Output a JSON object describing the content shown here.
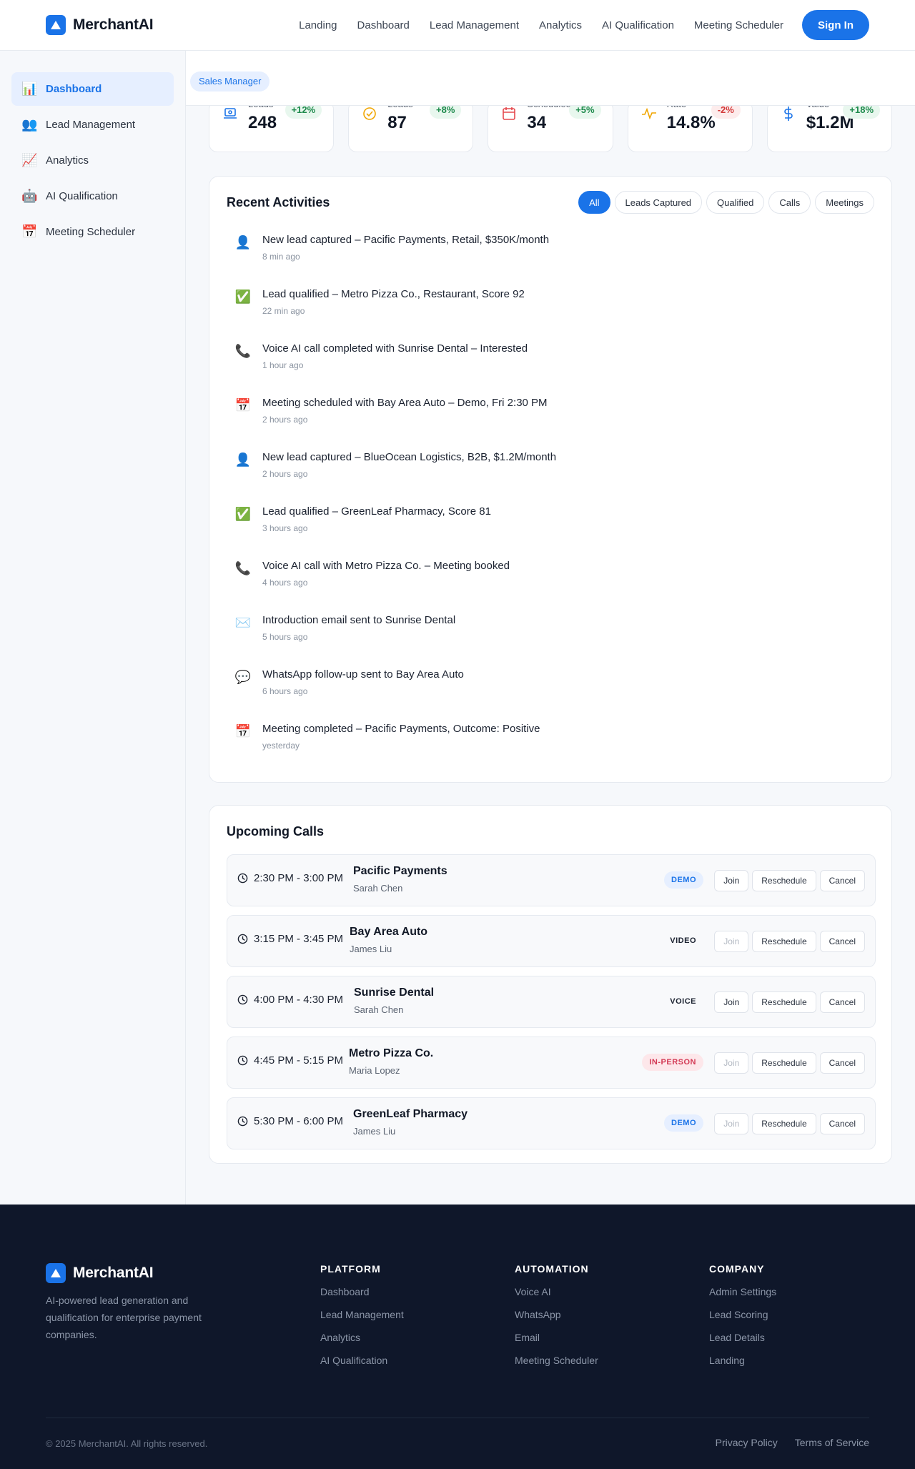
{
  "brand": {
    "name": "MerchantAI"
  },
  "nav": {
    "links": [
      "Landing",
      "Dashboard",
      "Lead Management",
      "Analytics",
      "AI Qualification",
      "Meeting Scheduler"
    ],
    "signin": "Sign In"
  },
  "sidebar": {
    "items": [
      {
        "label": "Dashboard",
        "icon": "bar-chart-icon",
        "glyph": "📊",
        "active": true
      },
      {
        "label": "Lead Management",
        "icon": "users-icon",
        "glyph": "👥",
        "active": false
      },
      {
        "label": "Analytics",
        "icon": "trend-chart-icon",
        "glyph": "📈",
        "active": false
      },
      {
        "label": "AI Qualification",
        "icon": "robot-icon",
        "glyph": "🤖",
        "active": false
      },
      {
        "label": "Meeting Scheduler",
        "icon": "calendar-icon",
        "glyph": "📅",
        "active": false
      }
    ]
  },
  "header": {
    "role": "Sales Manager"
  },
  "stats": [
    {
      "label": "Leads",
      "value": "248",
      "change": "+12%",
      "trend": "up",
      "icon": "laptop-icon",
      "color": "#1a73e8"
    },
    {
      "label": "Leads",
      "value": "87",
      "change": "+8%",
      "trend": "up",
      "icon": "check-circle-icon",
      "color": "#f0a500"
    },
    {
      "label": "Scheduled",
      "value": "34",
      "change": "+5%",
      "trend": "up",
      "icon": "calendar-icon",
      "color": "#e5484d"
    },
    {
      "label": "Rate",
      "value": "14.8%",
      "change": "-2%",
      "trend": "down",
      "icon": "activity-icon",
      "color": "#f0a500"
    },
    {
      "label": "Value",
      "value": "$1.2M",
      "change": "+18%",
      "trend": "up",
      "icon": "dollar-icon",
      "color": "#1a73e8"
    }
  ],
  "activities": {
    "title": "Recent Activities",
    "filters": [
      "All",
      "Leads Captured",
      "Qualified",
      "Calls",
      "Meetings"
    ],
    "items": [
      {
        "icon": "user-icon",
        "glyph": "👤",
        "text": "New lead captured – Pacific Payments, Retail, $350K/month",
        "time": "8 min ago"
      },
      {
        "icon": "check-icon",
        "glyph": "✅",
        "text": "Lead qualified – Metro Pizza Co., Restaurant, Score 92",
        "time": "22 min ago"
      },
      {
        "icon": "phone-icon",
        "glyph": "📞",
        "text": "Voice AI call completed with Sunrise Dental – Interested",
        "time": "1 hour ago"
      },
      {
        "icon": "calendar-icon",
        "glyph": "📅",
        "text": "Meeting scheduled with Bay Area Auto – Demo, Fri 2:30 PM",
        "time": "2 hours ago"
      },
      {
        "icon": "user-icon",
        "glyph": "👤",
        "text": "New lead captured – BlueOcean Logistics, B2B, $1.2M/month",
        "time": "2 hours ago"
      },
      {
        "icon": "check-icon",
        "glyph": "✅",
        "text": "Lead qualified – GreenLeaf Pharmacy, Score 81",
        "time": "3 hours ago"
      },
      {
        "icon": "phone-icon",
        "glyph": "📞",
        "text": "Voice AI call with Metro Pizza Co. – Meeting booked",
        "time": "4 hours ago"
      },
      {
        "icon": "mail-icon",
        "glyph": "✉️",
        "text": "Introduction email sent to Sunrise Dental",
        "time": "5 hours ago"
      },
      {
        "icon": "chat-icon",
        "glyph": "💬",
        "text": "WhatsApp follow-up sent to Bay Area Auto",
        "time": "6 hours ago"
      },
      {
        "icon": "calendar-icon",
        "glyph": "📅",
        "text": "Meeting completed – Pacific Payments, Outcome: Positive",
        "time": "yesterday"
      }
    ]
  },
  "calls": {
    "title": "Upcoming Calls",
    "actions": {
      "join": "Join",
      "reschedule": "Reschedule",
      "cancel": "Cancel"
    },
    "items": [
      {
        "time": "2:30 PM - 3:00 PM",
        "company": "Pacific Payments",
        "person": "Sarah Chen",
        "type": "DEMO",
        "style": "demo",
        "joinable": true
      },
      {
        "time": "3:15 PM - 3:45 PM",
        "company": "Bay Area Auto",
        "person": "James Liu",
        "type": "VIDEO",
        "style": "plain",
        "joinable": false
      },
      {
        "time": "4:00 PM - 4:30 PM",
        "company": "Sunrise Dental",
        "person": "Sarah Chen",
        "type": "VOICE",
        "style": "plain",
        "joinable": true
      },
      {
        "time": "4:45 PM - 5:15 PM",
        "company": "Metro Pizza Co.",
        "person": "Maria Lopez",
        "type": "IN-PERSON",
        "style": "inperson",
        "joinable": false
      },
      {
        "time": "5:30 PM - 6:00 PM",
        "company": "GreenLeaf Pharmacy",
        "person": "James Liu",
        "type": "DEMO",
        "style": "demo",
        "joinable": false
      }
    ]
  },
  "footer": {
    "description": "AI-powered lead generation and qualification for enterprise payment companies.",
    "columns": [
      {
        "title": "PLATFORM",
        "links": [
          "Dashboard",
          "Lead Management",
          "Analytics",
          "AI Qualification"
        ]
      },
      {
        "title": "AUTOMATION",
        "links": [
          "Voice AI",
          "WhatsApp",
          "Email",
          "Meeting Scheduler"
        ]
      },
      {
        "title": "COMPANY",
        "links": [
          "Admin Settings",
          "Lead Scoring",
          "Lead Details",
          "Landing"
        ]
      }
    ],
    "copyright": "© 2025 MerchantAI. All rights reserved.",
    "legal": [
      "Privacy Policy",
      "Terms of Service"
    ]
  },
  "colors": {
    "accent": "#1a73e8",
    "footer_bg": "#0f172a",
    "success": "#1e8a4c",
    "danger": "#d33a3a"
  }
}
